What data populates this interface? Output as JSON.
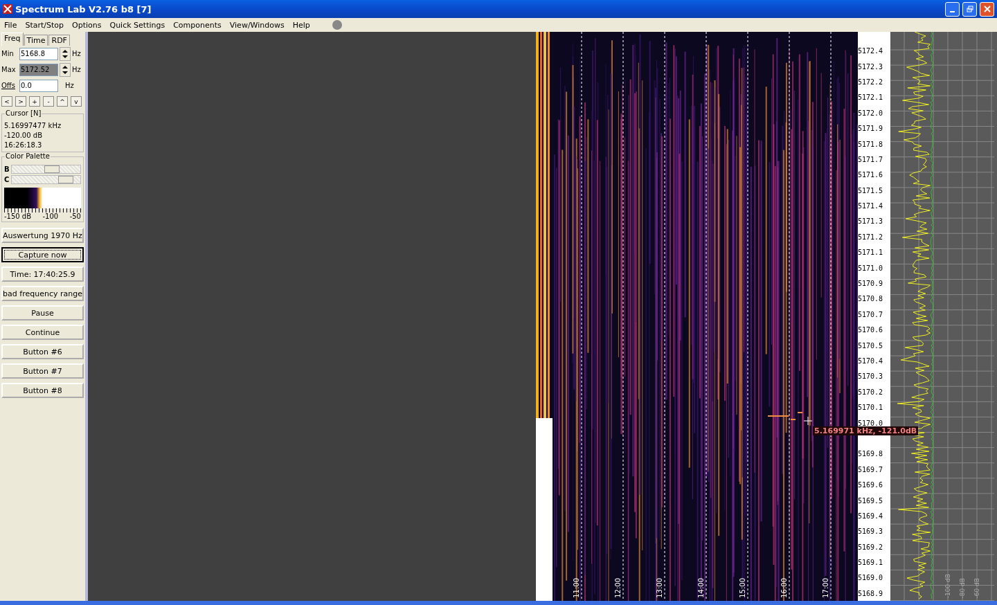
{
  "window": {
    "title": "Spectrum Lab V2.76 b8 [7]"
  },
  "menu": [
    "File",
    "Start/Stop",
    "Options",
    "Quick Settings",
    "Components",
    "View/Windows",
    "Help"
  ],
  "tabs": [
    {
      "label": "Freq",
      "selected": true
    },
    {
      "label": "Time",
      "selected": false
    },
    {
      "label": "RDF",
      "selected": false
    }
  ],
  "freq_fields": [
    {
      "label": "Min",
      "value": "5168.8",
      "unit": "Hz",
      "highlighted": false
    },
    {
      "label": "Max",
      "value": "5172.52",
      "unit": "Hz",
      "highlighted": true
    }
  ],
  "offset": {
    "label": "Offs",
    "value": "0.0",
    "unit": "Hz"
  },
  "nav_buttons": [
    "<",
    ">",
    "+",
    "-",
    "^",
    "v"
  ],
  "cursor": {
    "title": "Cursor [N]",
    "lines": [
      "5.16997477 kHz",
      "-120.00 dB",
      "16:26:18.3"
    ]
  },
  "palette": {
    "title": "Color Palette",
    "sliders": [
      {
        "label": "B",
        "level": 0.6
      },
      {
        "label": "C",
        "level": 0.85
      }
    ],
    "scale": [
      "-150 dB",
      "-100",
      "-50"
    ]
  },
  "buttons": [
    {
      "label": "Auswertung 1970 Hz",
      "focused": false
    },
    {
      "label": "Capture now",
      "focused": true
    },
    {
      "label": "Time:  17:40:25.9",
      "focused": false
    },
    {
      "label": "bad frequency range",
      "focused": false
    },
    {
      "label": "Pause",
      "focused": false
    },
    {
      "label": "Continue",
      "focused": false
    },
    {
      "label": "Button #6",
      "focused": false
    },
    {
      "label": "Button #7",
      "focused": false
    },
    {
      "label": "Button #8",
      "focused": false
    }
  ],
  "waterfall": {
    "time_labels": [
      "11:00",
      "12:00",
      "13:00",
      "14:00",
      "15:00",
      "16:00",
      "17:00"
    ],
    "marker": "5.169971 kHz, -121.0dB"
  },
  "freq_scale": [
    "5172.4",
    "5172.3",
    "5172.2",
    "5172.1",
    "5172.0",
    "5171.9",
    "5171.8",
    "5171.7",
    "5171.6",
    "5171.5",
    "5171.4",
    "5171.3",
    "5171.2",
    "5171.1",
    "5171.0",
    "5170.9",
    "5170.8",
    "5170.7",
    "5170.6",
    "5170.5",
    "5170.4",
    "5170.3",
    "5170.2",
    "5170.1",
    "5170.0"
  ],
  "freq_scale_lower": [
    "5169.8",
    "5169.7",
    "5169.6",
    "5169.5",
    "5169.4",
    "5169.3",
    "5169.2",
    "5169.1",
    "5169.0",
    "5168.9"
  ],
  "spectrum": {
    "db_labels": [
      "-100 dB",
      "-80 dB",
      "-60 dB"
    ]
  }
}
